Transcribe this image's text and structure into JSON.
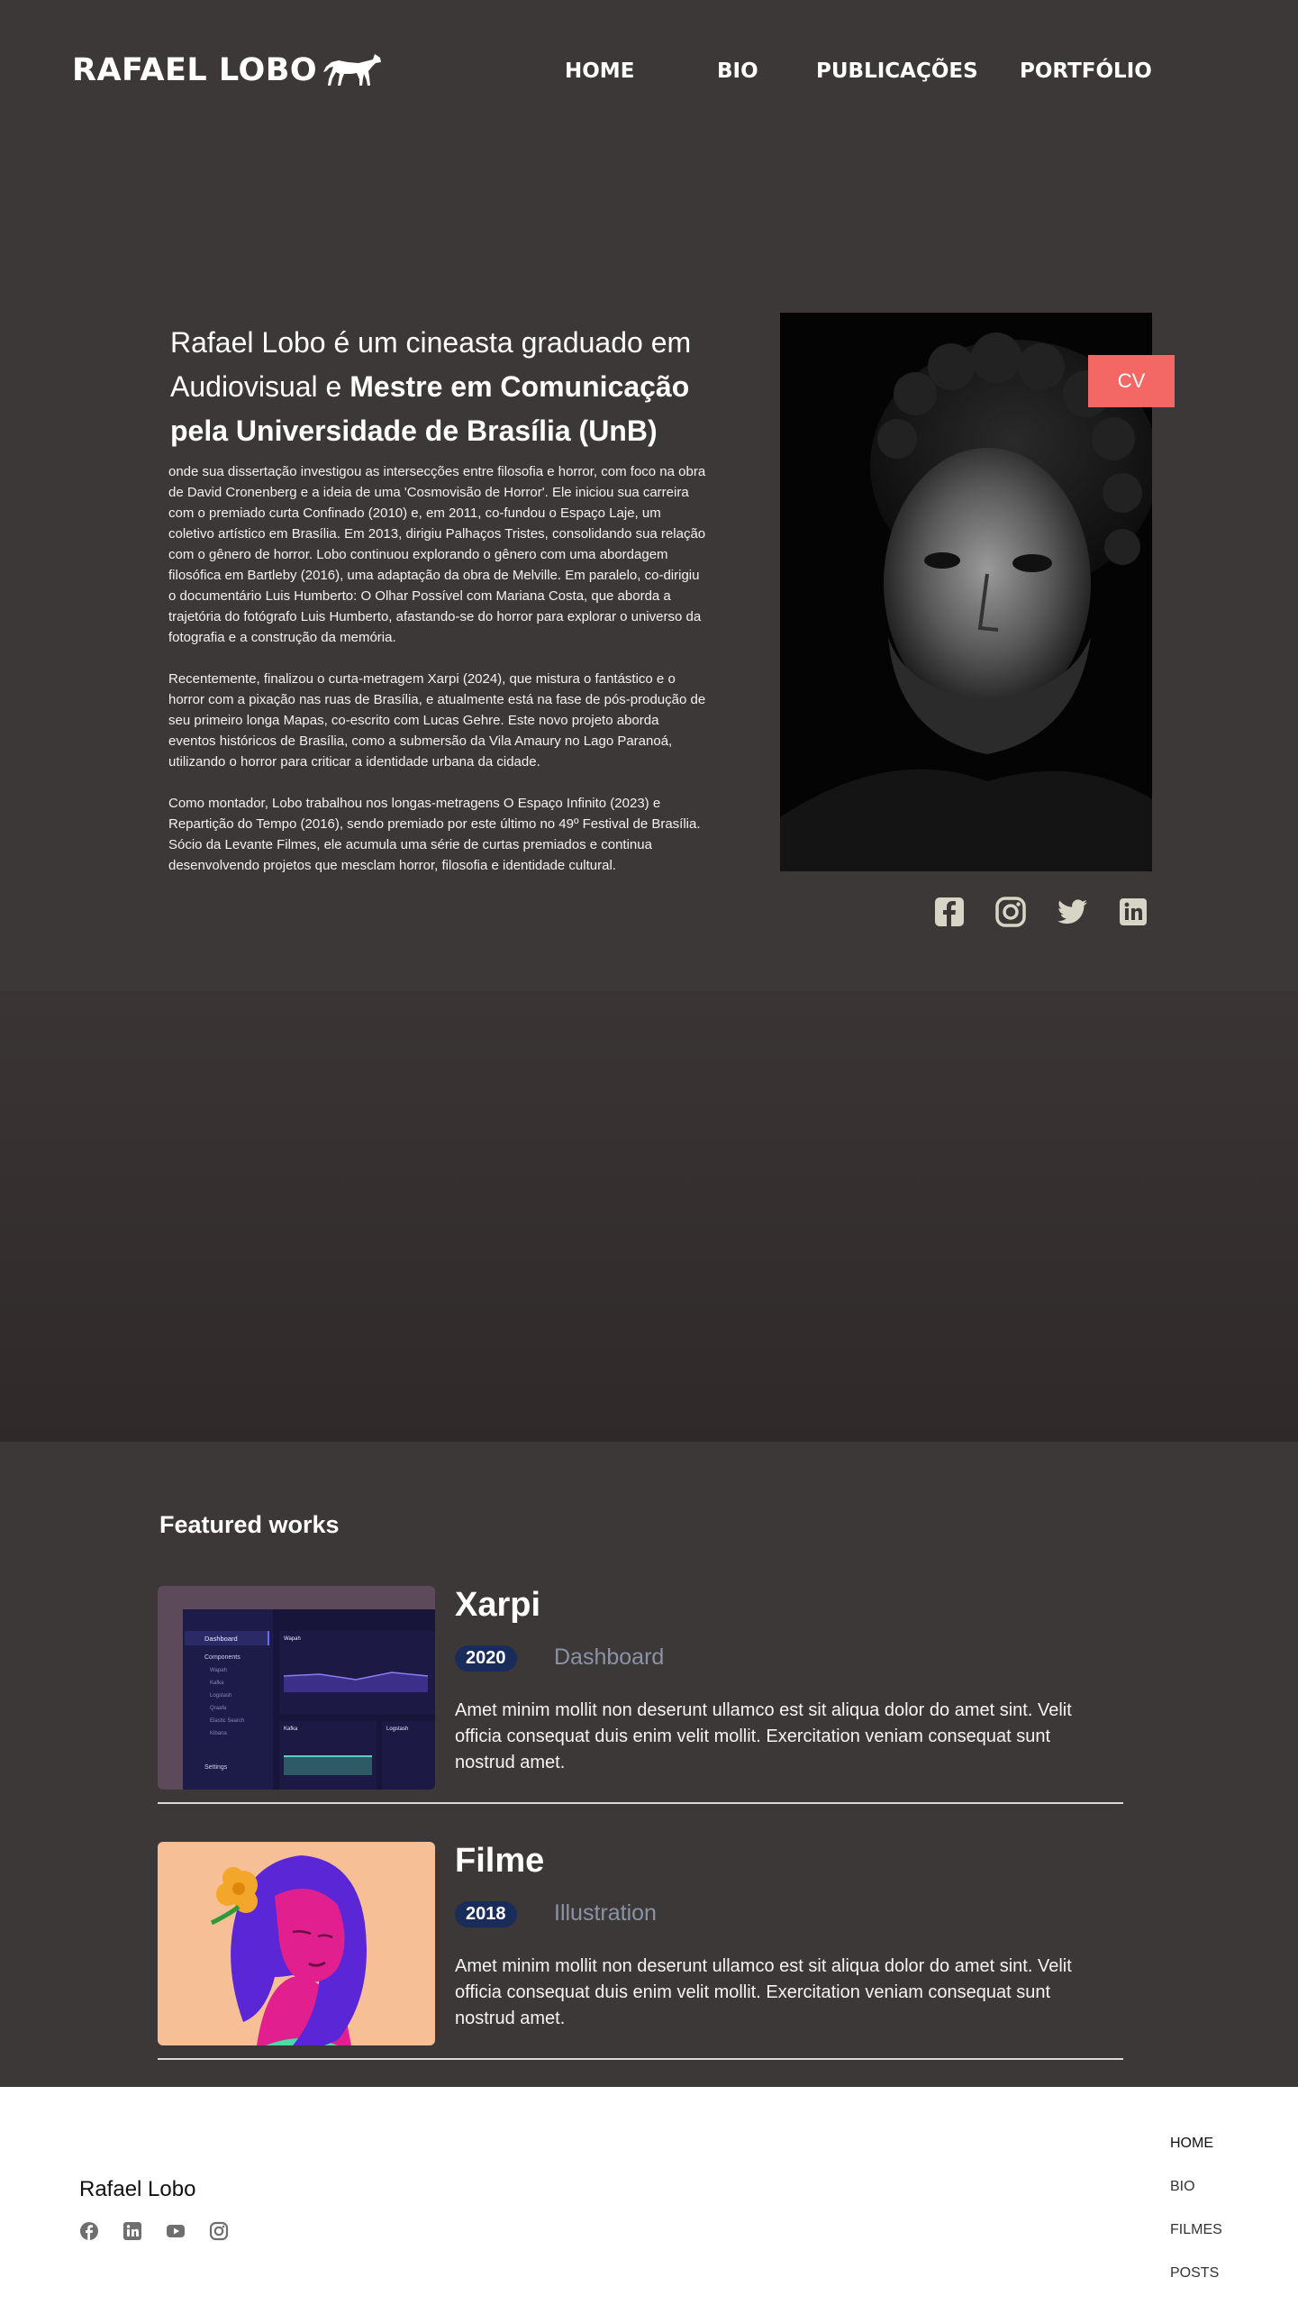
{
  "header": {
    "logo_text": "RAFAEL LOBO",
    "nav": [
      "HOME",
      "BIO",
      "PUBLICAÇÕES",
      "PORTFÓLIO"
    ]
  },
  "hero": {
    "lead_plain": "Rafael Lobo é um cineasta graduado em Audiovisual e ",
    "lead_bold": "Mestre em Comunicação pela Universidade de Brasília (UnB)",
    "bio_paragraphs": [
      "onde sua dissertação investigou as intersecções entre filosofia e horror, com foco na obra de David Cronenberg e a ideia de uma 'Cosmovisão de Horror'. Ele iniciou sua carreira com o premiado curta Confinado (2010) e, em 2011, co-fundou o Espaço Laje, um coletivo artístico em Brasília. Em 2013, dirigiu Palhaços Tristes, consolidando sua relação com o gênero de horror. Lobo continuou explorando o gênero com uma abordagem filosófica em Bartleby (2016), uma adaptação da obra de Melville. Em paralelo, co-dirigiu o documentário Luis Humberto: O Olhar Possível com Mariana Costa, que aborda a trajetória do fotógrafo Luis Humberto, afastando-se do horror para explorar o universo da fotografia e a construção da memória.",
      "Recentemente, finalizou o curta-metragem Xarpi (2024), que mistura o fantástico e o horror com a pixação nas ruas de Brasília, e atualmente está na fase de pós-produção de seu primeiro longa Mapas, co-escrito com Lucas Gehre. Este novo projeto aborda eventos históricos de Brasília, como a submersão da Vila Amaury no Lago Paranoá, utilizando o horror para criticar a identidade urbana da cidade.",
      "Como montador, Lobo trabalhou nos longas-metragens O Espaço Infinito (2023) e Repartição do Tempo (2016), sendo premiado por este último no 49º Festival de Brasília. Sócio da Levante Filmes, ele acumula uma série de curtas premiados e continua desenvolvendo projetos que mesclam horror, filosofia e identidade cultural."
    ],
    "cv_label": "CV",
    "socials": [
      "facebook-icon",
      "instagram-icon",
      "twitter-icon",
      "linkedin-icon"
    ]
  },
  "featured": {
    "title": "Featured works",
    "works": [
      {
        "title": "Xarpi",
        "year": "2020",
        "tag": "Dashboard",
        "description": "Amet minim mollit non deserunt ullamco est sit aliqua dolor do amet sint. Velit officia consequat duis enim velit mollit. Exercitation veniam consequat sunt nostrud amet.",
        "thumb": {
          "menu": [
            "Dashboard",
            "Components",
            "Wapah",
            "Kafka",
            "Logstash",
            "Qraafa",
            "Elastic Search",
            "Kibana",
            "Settings"
          ],
          "panel_a": "Wapah",
          "panel_b": "Kafka",
          "panel_c": "Logstash"
        }
      },
      {
        "title": "Filme",
        "year": "2018",
        "tag": "Illustration",
        "description": "Amet minim mollit non deserunt ullamco est sit aliqua dolor do amet sint. Velit officia consequat duis enim velit mollit. Exercitation veniam consequat sunt nostrud amet."
      }
    ]
  },
  "footer": {
    "brand": "Rafael Lobo",
    "socials": [
      "facebook-icon",
      "linkedin-icon",
      "youtube-icon",
      "instagram-icon"
    ],
    "nav": [
      "HOME",
      "BIO",
      "FILMES",
      "POSTS"
    ]
  },
  "colors": {
    "background": "#3c3837",
    "cv_button": "#f36764",
    "year_badge": "#1a2c5a",
    "social_icon": "#d8d4c6"
  }
}
